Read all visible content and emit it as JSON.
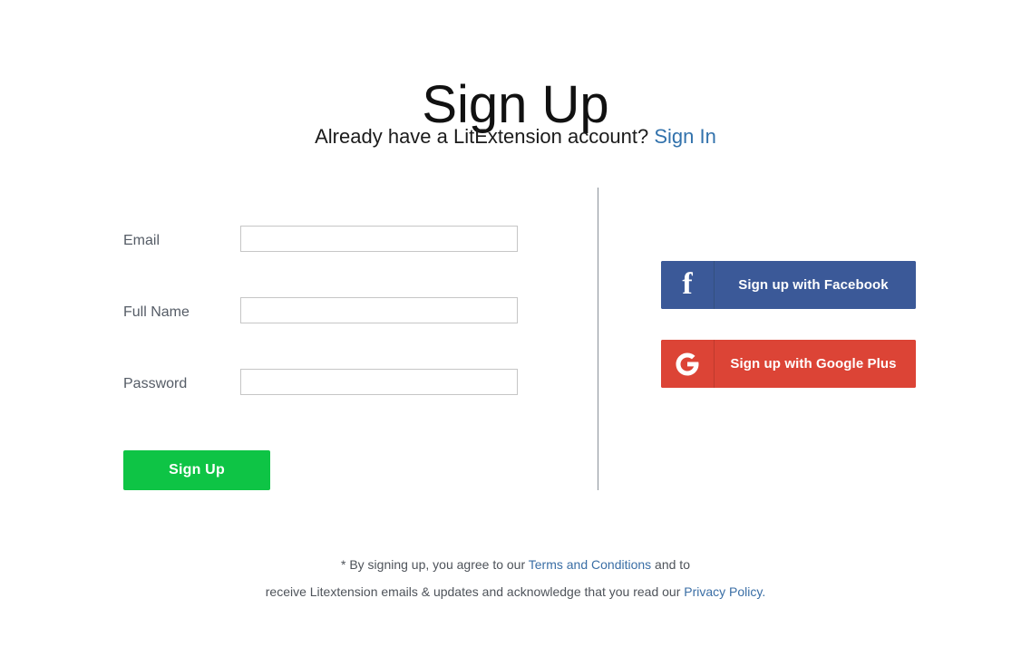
{
  "header": {
    "title": "Sign Up",
    "subtitle_prefix": "Already have a LitExtension account? ",
    "signin_link": "Sign In"
  },
  "form": {
    "fields": [
      {
        "label": "Email",
        "value": "",
        "placeholder": "",
        "name": "email"
      },
      {
        "label": "Full Name",
        "value": "",
        "placeholder": "",
        "name": "fullname"
      },
      {
        "label": "Password",
        "value": "",
        "placeholder": "",
        "name": "password"
      }
    ],
    "submit_label": "Sign Up"
  },
  "social": {
    "facebook": {
      "label": "Sign up with Facebook",
      "icon": "facebook-f-icon",
      "icon_glyph": "f",
      "color": "#3b5998"
    },
    "google": {
      "label": "Sign up with Google Plus",
      "icon": "google-g-icon",
      "icon_glyph": "G",
      "color": "#dc4436"
    }
  },
  "legal": {
    "line1_prefix": "* By signing up, you agree to our ",
    "terms_link": "Terms and Conditions",
    "line1_suffix": " and to",
    "line2_prefix": "receive Litextension emails & updates and acknowledge that you read our ",
    "privacy_link": "Privacy Policy."
  },
  "colors": {
    "accent_green": "#0ec445",
    "link_blue": "#3272ac",
    "facebook_blue": "#3b5998",
    "google_red": "#dc4436",
    "label_gray": "#555c66"
  }
}
